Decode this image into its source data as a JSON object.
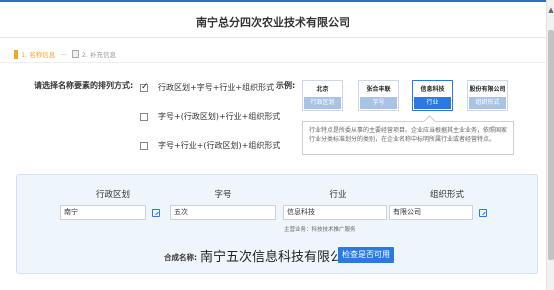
{
  "page": {
    "title": "南宁总分四次农业技术有限公司"
  },
  "steps": {
    "step1": "1. 名称信息",
    "separator": "—",
    "step2": "2. 补充信息"
  },
  "order": {
    "label": "请选择名称要素的排列方式:",
    "options": [
      {
        "text": "行政区划+字号+行业+组织形式",
        "checked": true
      },
      {
        "text": "字号+(行政区划)+行业+组织形式",
        "checked": false
      },
      {
        "text": "字号+行业+(行政区划)+组织形式",
        "checked": false
      }
    ]
  },
  "example": {
    "label": "示例:",
    "boxes": [
      {
        "top": "北京",
        "bottom": "行政区划",
        "active": false
      },
      {
        "top": "张合丰联",
        "bottom": "字号",
        "active": false
      },
      {
        "top": "信息科技",
        "bottom": "行业",
        "active": true
      },
      {
        "top": "股份有限公司",
        "bottom": "组织形式",
        "active": false
      }
    ],
    "tip": "行业特点是所委从事的主要经营项目。企业应当根据其主业业务，依照国家行业分类标准划分的类别，在企业名称中标明所属行业或者经营特点。"
  },
  "fields": {
    "headers": [
      "行政区划",
      "字号",
      "行业",
      "组织形式"
    ],
    "values": [
      "南宁",
      "五次",
      "信息科技",
      "有限公司"
    ],
    "industry_note": "主营业务：科技技术推广服务"
  },
  "result": {
    "label": "合成名称:",
    "name": "南宁五次信息科技有限公司",
    "check_button": "检查是否可用"
  },
  "colors": {
    "accent": "#2a7ae2",
    "step_active": "#f5a623",
    "panel_bg": "#eef5fb"
  }
}
